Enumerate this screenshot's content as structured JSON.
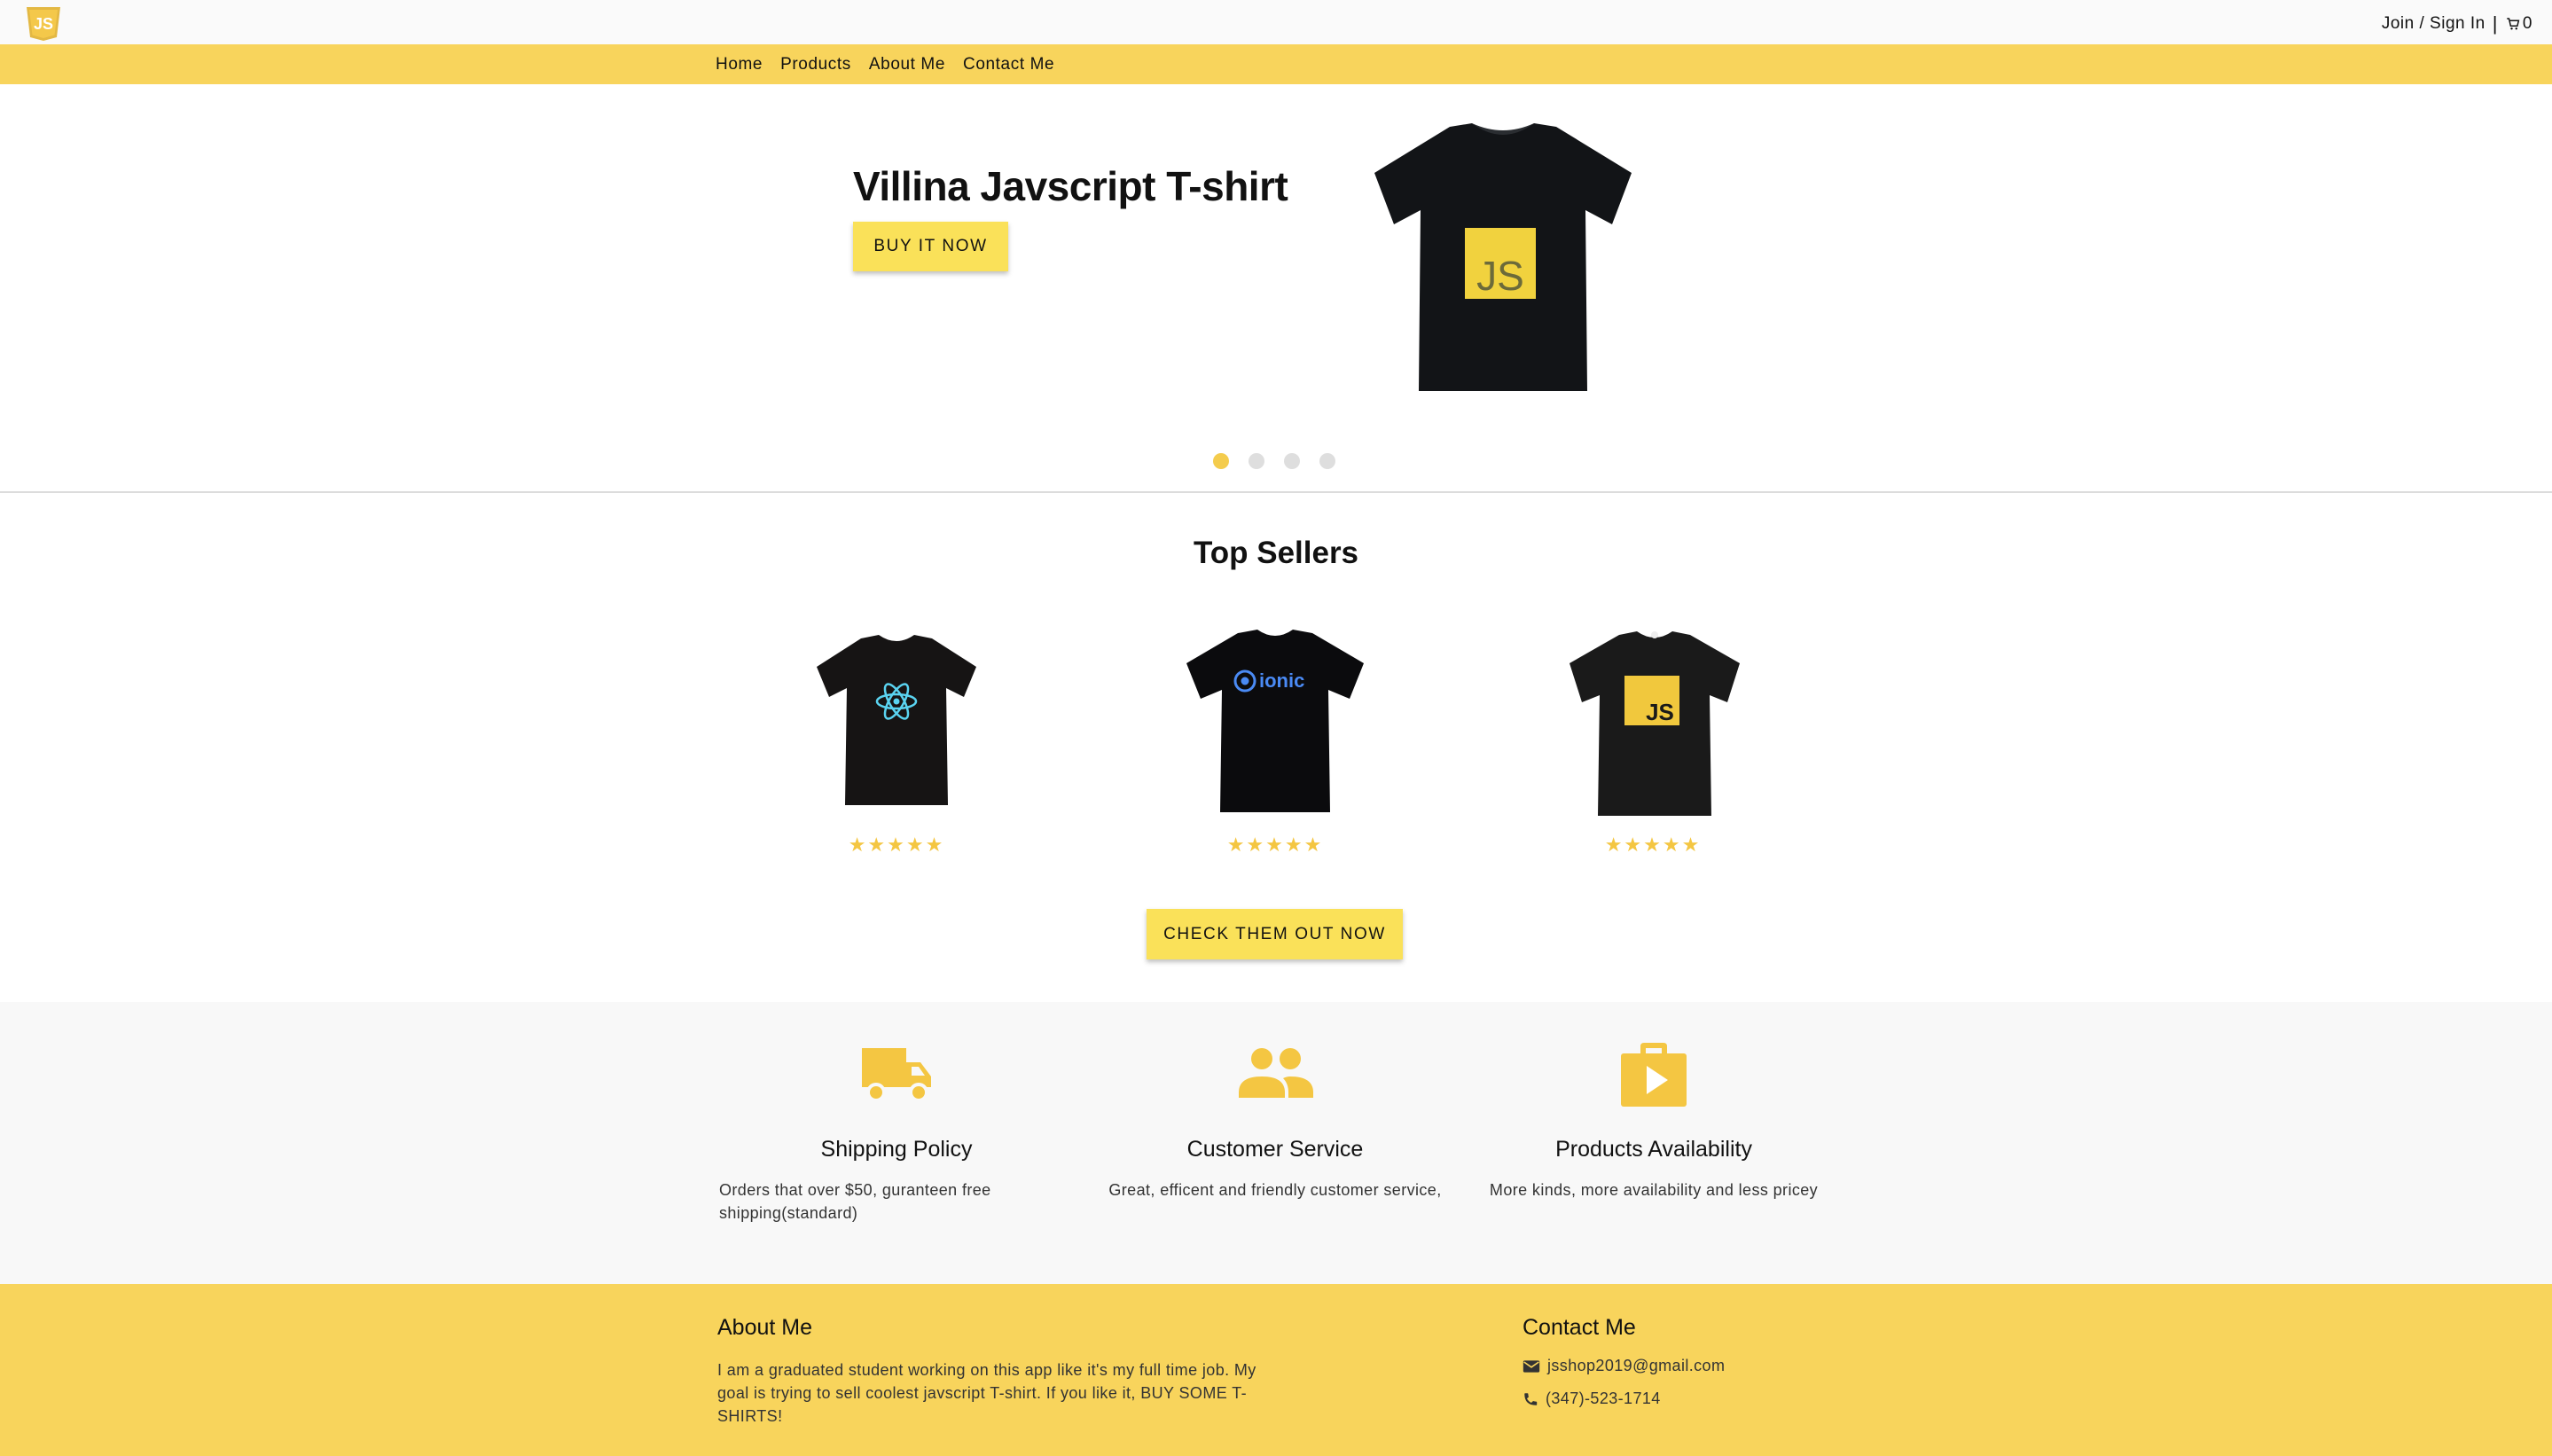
{
  "topbar": {
    "logo_text": "JS",
    "account_link": "Join / Sign In",
    "separator": "|",
    "cart_count": "0",
    "cart_icon": "cart-icon"
  },
  "nav": {
    "home": "Home",
    "products": "Products",
    "about": "About Me",
    "contact": "Contact Me"
  },
  "hero": {
    "title": "Villina Javscript T-shirt",
    "button": "BUY IT NOW",
    "image_logo_text": "JS",
    "slides_count": 4,
    "active_slide": 1
  },
  "top_sellers": {
    "title": "Top Sellers",
    "products": [
      {
        "image": "react-tshirt",
        "rating": 5
      },
      {
        "image": "ionic-tshirt",
        "logo_text": "ionic",
        "rating": 5
      },
      {
        "image": "js-tshirt",
        "logo_text": "JS",
        "rating": 5
      }
    ],
    "button": "CHECK THEM OUT NOW"
  },
  "features": [
    {
      "icon": "truck-icon",
      "title": "Shipping Policy",
      "text": "Orders that over $50, guranteen free shipping(standard)"
    },
    {
      "icon": "people-icon",
      "title": "Customer Service",
      "text": "Great, efficent and friendly customer service,"
    },
    {
      "icon": "shop-icon",
      "title": "Products Availability",
      "text": "More kinds, more availability and less pricey"
    }
  ],
  "footer": {
    "about_title": "About Me",
    "about_text": "I am a graduated student working on this app like it's my full time job. My goal is trying to sell coolest javscript T-shirt. If you like it, BUY SOME T-SHIRTS!",
    "contact_title": "Contact Me",
    "email": "jsshop2019@gmail.com",
    "phone": "(347)-523-1714"
  },
  "colors": {
    "accent": "#f8d45c",
    "button": "#fae159",
    "star": "#f4c642",
    "icon": "#f4c642"
  }
}
